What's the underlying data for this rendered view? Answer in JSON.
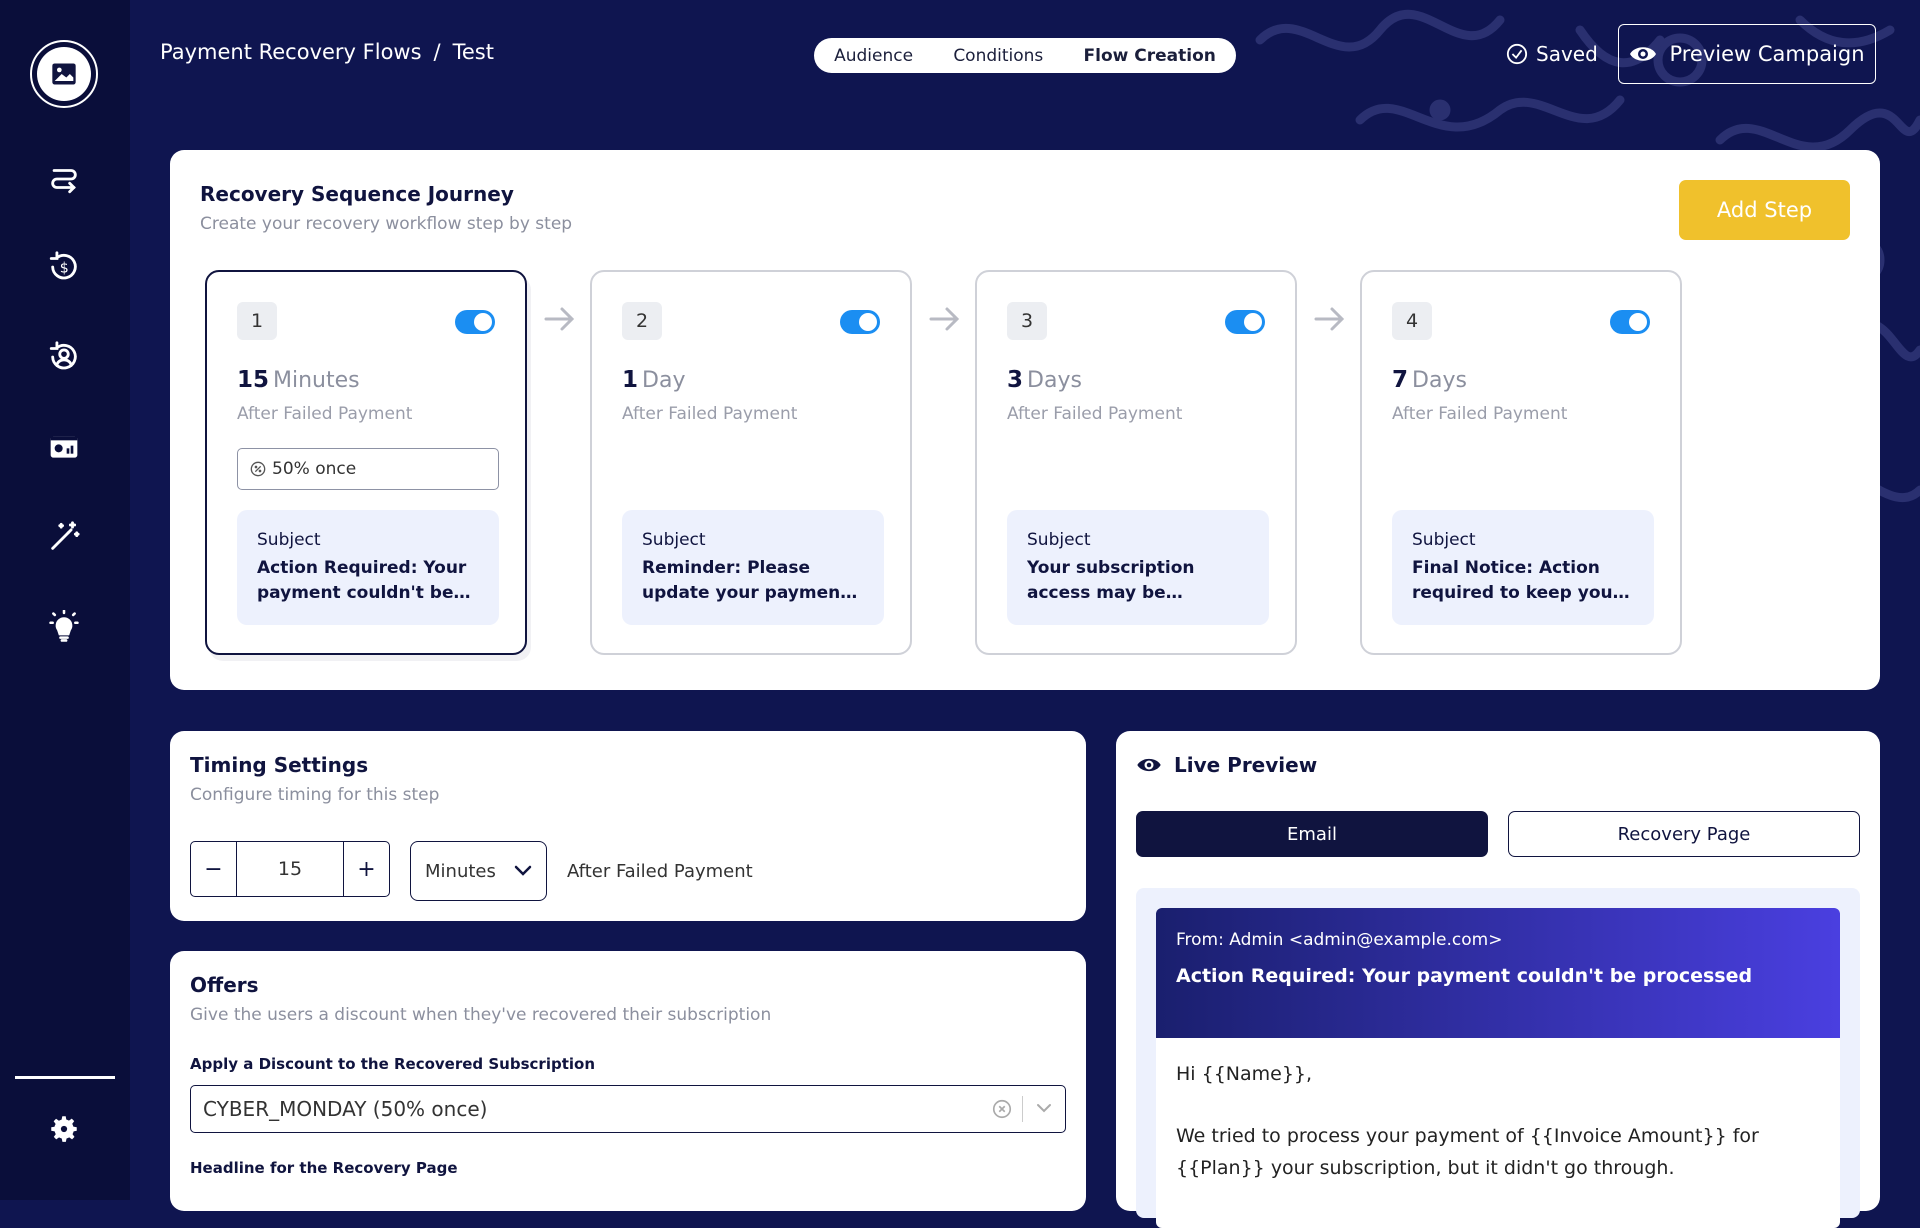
{
  "breadcrumb": {
    "parent": "Payment Recovery Flows",
    "separator": "/",
    "current": "Test"
  },
  "tabs": [
    {
      "label": "Audience",
      "active": false
    },
    {
      "label": "Conditions",
      "active": false
    },
    {
      "label": "Flow Creation",
      "active": true
    }
  ],
  "status": {
    "saved_label": "Saved"
  },
  "header": {
    "preview_label": "Preview Campaign"
  },
  "sidebar": {
    "icons": [
      "image-icon",
      "flows-icon",
      "dollar-refresh-icon",
      "user-refresh-icon",
      "dashboard-card-icon",
      "magic-wand-icon",
      "lightbulb-icon"
    ],
    "settings_icon": "gear-icon"
  },
  "journey": {
    "title": "Recovery Sequence Journey",
    "subtitle": "Create your recovery workflow step by step",
    "add_step_label": "Add Step",
    "steps": [
      {
        "number": "1",
        "amount": "15",
        "unit": "Minutes",
        "after": "After Failed Payment",
        "offer": "50% once",
        "subject_label": "Subject",
        "subject": "Action Required: Your payment couldn't be processed",
        "enabled": true,
        "active": true
      },
      {
        "number": "2",
        "amount": "1",
        "unit": "Day",
        "after": "After Failed Payment",
        "subject_label": "Subject",
        "subject": "Reminder: Please update your payment details",
        "enabled": true,
        "active": false
      },
      {
        "number": "3",
        "amount": "3",
        "unit": "Days",
        "after": "After Failed Payment",
        "subject_label": "Subject",
        "subject": "Your subscription access may be affected soon",
        "enabled": true,
        "active": false
      },
      {
        "number": "4",
        "amount": "7",
        "unit": "Days",
        "after": "After Failed Payment",
        "subject_label": "Subject",
        "subject": "Final Notice: Action required to keep your subscription",
        "enabled": true,
        "active": false
      }
    ]
  },
  "timing": {
    "title": "Timing Settings",
    "subtitle": "Configure timing for this step",
    "value": "15",
    "decrement": "−",
    "increment": "+",
    "unit": "Minutes",
    "after": "After Failed Payment"
  },
  "offers": {
    "title": "Offers",
    "subtitle": "Give the users a discount when they've recovered their subscription",
    "discount_label": "Apply a Discount to the Recovered Subscription",
    "discount_value": "CYBER_MONDAY (50% once)",
    "headline_label": "Headline for the Recovery Page"
  },
  "live_preview": {
    "title": "Live Preview",
    "tab_email": "Email",
    "tab_page": "Recovery Page",
    "from": "From: Admin <admin@example.com>",
    "subject": "Action Required: Your payment couldn't be processed",
    "greeting": "Hi {{Name}},",
    "body": "We tried to process your payment of {{Invoice Amount}} for {{Plan}} your subscription, but it didn't go through."
  },
  "colors": {
    "background": "#0f1550",
    "sidebar": "#0a0e3a",
    "accent": "#f0c12c",
    "toggle": "#1b8ef2",
    "navy": "#10143f"
  }
}
